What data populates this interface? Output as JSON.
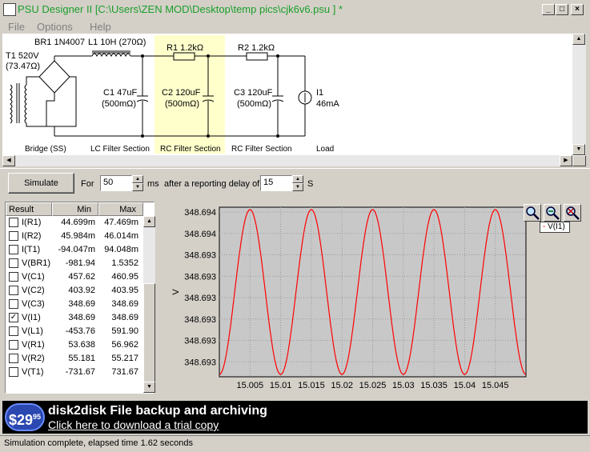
{
  "window": {
    "title": "PSU Designer II  [C:\\Users\\ZEN MOD\\Desktop\\temp pics\\cjk6v6.psu ] *"
  },
  "menu": {
    "items": [
      "File",
      "Options",
      "Help"
    ]
  },
  "schematic": {
    "components": {
      "transformer": [
        "T1 520V",
        "(73.47Ω)"
      ],
      "rectifier": "BR1 1N4007",
      "inductor": "L1 10H (270Ω)",
      "r1": "R1 1.2kΩ",
      "r2": "R2 1.2kΩ",
      "c1": [
        "C1 47uF",
        "(500mΩ)"
      ],
      "c2": [
        "C2 120uF",
        "(500mΩ)"
      ],
      "c3": [
        "C3 120uF",
        "(500mΩ)"
      ],
      "load": [
        "I1",
        "46mA"
      ]
    },
    "sections": [
      "Bridge (SS)",
      "LC Filter Section",
      "RC Filter Section",
      "RC Filter Section",
      "Load"
    ]
  },
  "controls": {
    "simulate_label": "Simulate",
    "for_label": "For",
    "for_value": "50",
    "ms_label": "ms",
    "delay_label": "after a reporting delay of",
    "delay_value": "15",
    "s_label": "S"
  },
  "results": {
    "headers": [
      "Result",
      "Min",
      "Max"
    ],
    "rows": [
      {
        "name": "I(R1)",
        "min": "44.699m",
        "max": "47.469m",
        "checked": false
      },
      {
        "name": "I(R2)",
        "min": "45.984m",
        "max": "46.014m",
        "checked": false
      },
      {
        "name": "I(T1)",
        "min": "-94.047m",
        "max": "94.048m",
        "checked": false
      },
      {
        "name": "V(BR1)",
        "min": "-981.94",
        "max": "1.5352",
        "checked": false
      },
      {
        "name": "V(C1)",
        "min": "457.62",
        "max": "460.95",
        "checked": false
      },
      {
        "name": "V(C2)",
        "min": "403.92",
        "max": "403.95",
        "checked": false
      },
      {
        "name": "V(C3)",
        "min": "348.69",
        "max": "348.69",
        "checked": false
      },
      {
        "name": "V(I1)",
        "min": "348.69",
        "max": "348.69",
        "checked": true
      },
      {
        "name": "V(L1)",
        "min": "-453.76",
        "max": "591.90",
        "checked": false
      },
      {
        "name": "V(R1)",
        "min": "53.638",
        "max": "56.962",
        "checked": false
      },
      {
        "name": "V(R2)",
        "min": "55.181",
        "max": "55.217",
        "checked": false
      },
      {
        "name": "V(T1)",
        "min": "-731.67",
        "max": "731.67",
        "checked": false
      }
    ]
  },
  "chart_data": {
    "type": "line",
    "ylabel": "V",
    "y_ticks": [
      "348.694",
      "348.694",
      "348.693",
      "348.693",
      "348.693",
      "348.693",
      "348.693",
      "348.693"
    ],
    "x_ticks": [
      "15.005",
      "15.01",
      "15.015",
      "15.02",
      "15.025",
      "15.03",
      "15.035",
      "15.04",
      "15.045"
    ],
    "xlim": [
      15.0,
      15.05
    ],
    "series": [
      {
        "name": "V(I1)",
        "color": "#ff0000",
        "period": 0.01,
        "peaks_x": [
          15.005,
          15.015,
          15.025,
          15.035,
          15.045
        ],
        "min": 348.6928,
        "max": 348.6942
      }
    ],
    "grid": true,
    "legend": "top-right"
  },
  "zoom_icons": [
    "zoom-in-icon",
    "zoom-fit-icon",
    "zoom-out-icon"
  ],
  "ad": {
    "price_main": "$29",
    "price_cents": "95",
    "headline": "disk2disk File backup and archiving",
    "link": "Click here to download a trial copy"
  },
  "status": {
    "text": "Simulation complete, elapsed time 1.62 seconds"
  }
}
